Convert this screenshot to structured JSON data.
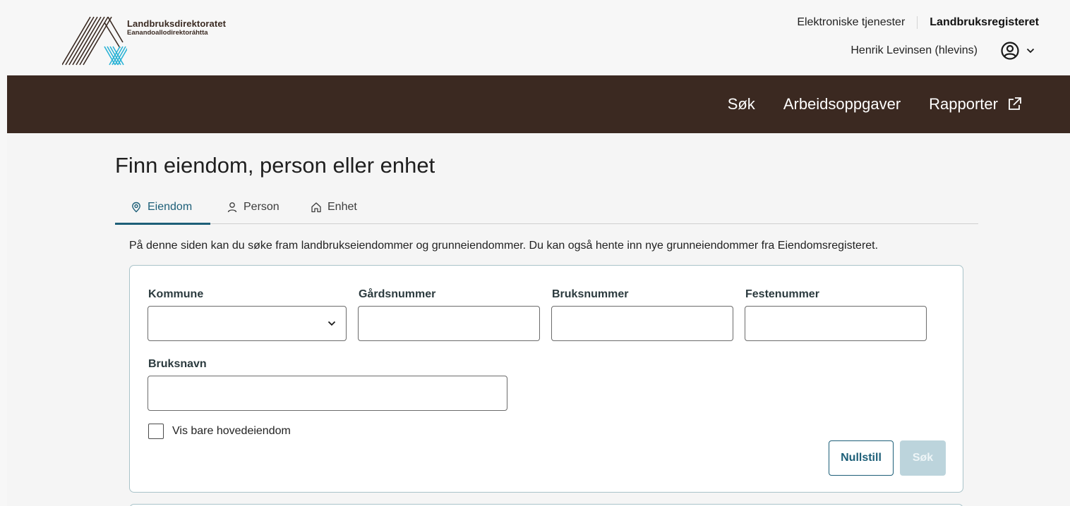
{
  "header": {
    "logo_name": "Landbruksdirektoratet",
    "logo_subname": "Eanandoallodirektoráhtta",
    "top_links": [
      "Elektroniske tjenester",
      "Landbruksregisteret"
    ],
    "user_name": "Henrik Levinsen (hlevins)",
    "user_icon": "user-circle-icon"
  },
  "nav": {
    "items": [
      "Søk",
      "Arbeidsoppgaver",
      "Rapporter"
    ],
    "external_icon": "external-link-icon"
  },
  "main": {
    "title": "Finn eiendom, person eller enhet",
    "tabs": [
      {
        "label": "Eiendom",
        "icon": "location-pin-icon",
        "active": true
      },
      {
        "label": "Person",
        "icon": "person-icon",
        "active": false
      },
      {
        "label": "Enhet",
        "icon": "house-icon",
        "active": false
      }
    ],
    "intro": "På denne siden kan du søke fram landbrukseiendommer og grunneiendommer. Du kan også hente inn nye grunneiendommer fra Eiendomsregisteret."
  },
  "form": {
    "kommune_label": "Kommune",
    "kommune_value": "",
    "gardsnummer_label": "Gårdsnummer",
    "gardsnummer_value": "",
    "bruksnummer_label": "Bruksnummer",
    "bruksnummer_value": "",
    "festenummer_label": "Festenummer",
    "festenummer_value": "",
    "bruksnavn_label": "Bruksnavn",
    "bruksnavn_value": "",
    "checkbox_label": "Vis bare hovedeiendom",
    "checkbox_checked": false,
    "reset_label": "Nullstill",
    "search_label": "Søk"
  },
  "colors": {
    "nav_bg": "#3b2921",
    "accent": "#1d5f78",
    "logo_brown": "#3a2a22",
    "logo_cyan": "#2bb3d6",
    "disabled_button": "#bcd4dc"
  }
}
